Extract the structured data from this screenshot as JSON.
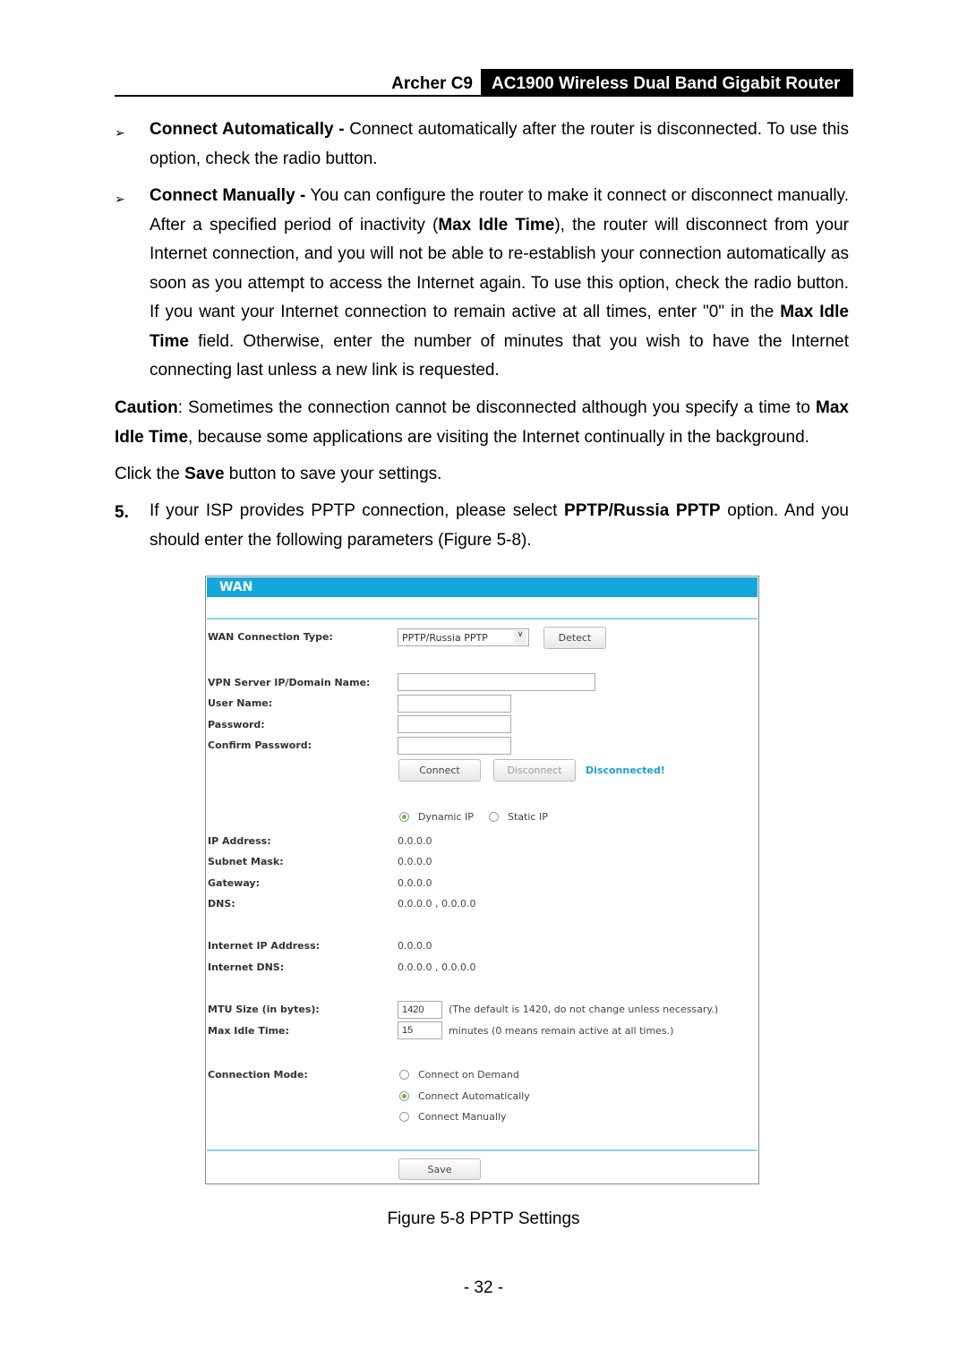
{
  "header": {
    "model": "Archer C9",
    "product": "AC1900 Wireless Dual Band Gigabit Router"
  },
  "bullets": [
    {
      "icon": "arrow-bullet-icon",
      "term": "Connect Automatically -",
      "text": " Connect automatically after the router is disconnected. To use this option, check the radio button."
    },
    {
      "icon": "arrow-bullet-icon",
      "term": "Connect Manually -",
      "t1": " You can configure the router to make it connect or disconnect manually. After a specified period of inactivity (",
      "b1": "Max Idle Time",
      "t2": "), the router will disconnect from your Internet connection, and you will not be able to re-establish your connection automatically as soon as you attempt to access the Internet again. To use this option, check the radio button. If you want your Internet connection to remain active at all times, enter \"0\" in the ",
      "b2": "Max Idle Time",
      "t3": " field. Otherwise, enter the number of minutes that you wish to have the Internet connecting last unless a new link is requested."
    }
  ],
  "caution": {
    "term": "Caution",
    "t1": ": Sometimes the connection cannot be disconnected although you specify a time to ",
    "b1": "Max Idle Time",
    "t2": ", because some applications are visiting the Internet continually in the background."
  },
  "save_note": {
    "t1": "Click the ",
    "b1": "Save",
    "t2": " button to save your settings."
  },
  "step5": {
    "num": "5.",
    "t1": "If your ISP provides PPTP connection, please select ",
    "b1": "PPTP/Russia PPTP",
    "t2": " option. And you should enter the following parameters (Figure 5-8)."
  },
  "wan": {
    "title": "WAN",
    "conn_type_label": "WAN Connection Type:",
    "conn_type_value": "PPTP/Russia PPTP",
    "detect": "Detect",
    "vpn_label": "VPN Server IP/Domain Name:",
    "user_label": "User Name:",
    "pass_label": "Password:",
    "confirm_label": "Confirm Password:",
    "vpn_value": "",
    "user_value": "",
    "pass_value": "",
    "confirm_value": "",
    "connect": "Connect",
    "disconnect": "Disconnect",
    "status": "Disconnected!",
    "status_color": "#1a9fd6",
    "ip_modes": [
      {
        "label": "Dynamic IP",
        "checked": true
      },
      {
        "label": "Static IP",
        "checked": false
      }
    ],
    "ip_label": "IP Address:",
    "ip": "0.0.0.0",
    "mask_label": "Subnet Mask:",
    "mask": "0.0.0.0",
    "gw_label": "Gateway:",
    "gw": "0.0.0.0",
    "dns_label": "DNS:",
    "dns": "0.0.0.0 , 0.0.0.0",
    "iip_label": "Internet IP Address:",
    "iip": "0.0.0.0",
    "idns_label": "Internet DNS:",
    "idns": "0.0.0.0 , 0.0.0.0",
    "mtu_label": "MTU Size (in bytes):",
    "mtu": "1420",
    "mtu_hint": "(The default is 1420, do not change unless necessary.)",
    "idle_label": "Max Idle Time:",
    "idle": "15",
    "idle_hint": "minutes (0 means remain active at all times.)",
    "mode_label": "Connection Mode:",
    "modes": [
      {
        "label": "Connect on Demand",
        "checked": false
      },
      {
        "label": "Connect Automatically",
        "checked": true
      },
      {
        "label": "Connect Manually",
        "checked": false
      }
    ],
    "save": "Save",
    "accent": "#12a8de"
  },
  "caption": "Figure 5-8 PPTP Settings",
  "page_number": "- 32 -"
}
